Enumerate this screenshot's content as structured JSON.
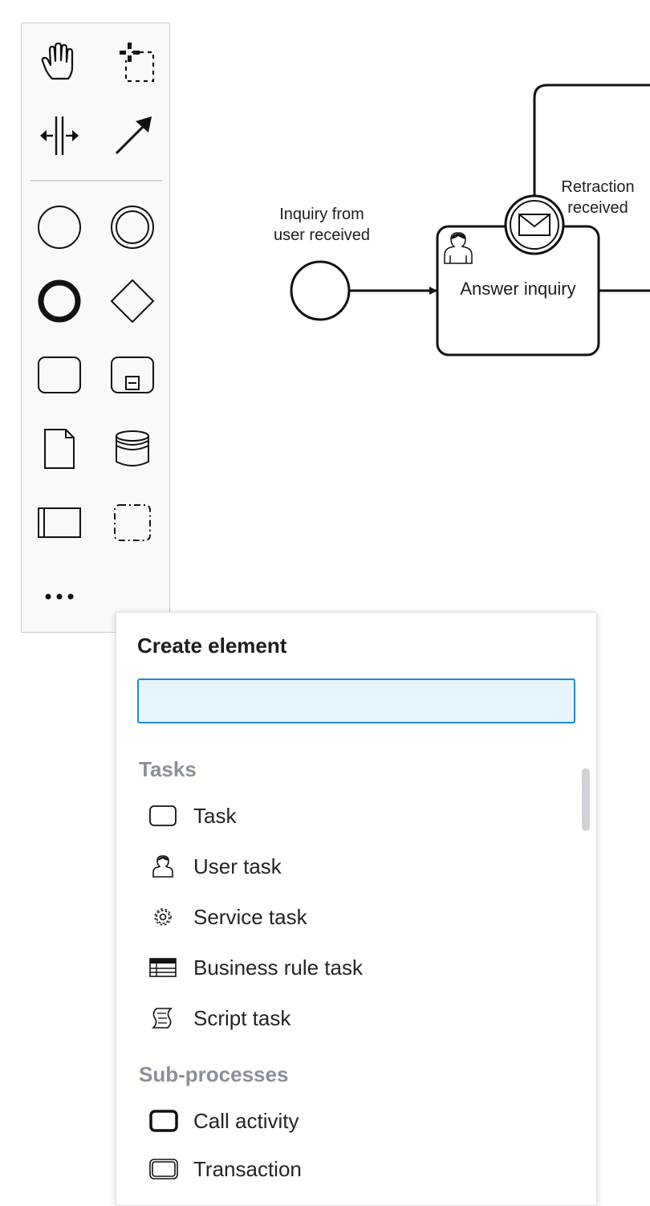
{
  "diagram": {
    "start_event_label_line1": "Inquiry from",
    "start_event_label_line2": "user received",
    "task_label": "Answer inquiry",
    "boundary_label_line1": "Retraction",
    "boundary_label_line2": "received"
  },
  "palette": {
    "tools": [
      {
        "name": "hand-tool",
        "icon": "hand-icon"
      },
      {
        "name": "lasso-tool",
        "icon": "lasso-icon"
      },
      {
        "name": "space-tool",
        "icon": "space-icon"
      },
      {
        "name": "global-connect-tool",
        "icon": "arrow-icon"
      },
      {
        "name": "create-start-event",
        "icon": "start-event-icon"
      },
      {
        "name": "create-intermediate-event",
        "icon": "intermediate-event-icon"
      },
      {
        "name": "create-end-event",
        "icon": "end-event-icon"
      },
      {
        "name": "create-gateway",
        "icon": "gateway-icon"
      },
      {
        "name": "create-task",
        "icon": "task-icon"
      },
      {
        "name": "create-subprocess",
        "icon": "subprocess-icon"
      },
      {
        "name": "create-data-object",
        "icon": "data-object-icon"
      },
      {
        "name": "create-data-store",
        "icon": "data-store-icon"
      },
      {
        "name": "create-pool",
        "icon": "pool-icon"
      },
      {
        "name": "create-group",
        "icon": "group-icon"
      },
      {
        "name": "more-tools",
        "icon": "ellipsis-icon"
      }
    ]
  },
  "popup": {
    "title": "Create element",
    "search_value": "",
    "groups": [
      {
        "heading": "Tasks",
        "entries": [
          {
            "label": "Task",
            "icon": "task-icon"
          },
          {
            "label": "User task",
            "icon": "user-icon"
          },
          {
            "label": "Service task",
            "icon": "gear-icon"
          },
          {
            "label": "Business rule task",
            "icon": "table-icon"
          },
          {
            "label": "Script task",
            "icon": "script-icon"
          }
        ]
      },
      {
        "heading": "Sub-processes",
        "entries": [
          {
            "label": "Call activity",
            "icon": "call-activity-icon"
          },
          {
            "label": "Transaction",
            "icon": "transaction-icon"
          }
        ]
      }
    ]
  },
  "colors": {
    "search_border": "#1a8ae0",
    "search_bg": "#e6f4fe",
    "group_heading": "#8a8f9b"
  }
}
